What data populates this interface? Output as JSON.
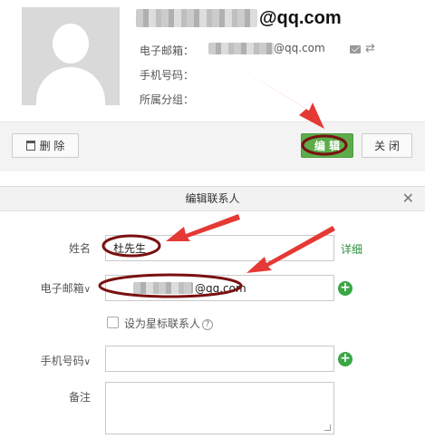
{
  "card": {
    "name_suffix": "@qq.com",
    "labels": {
      "email": "电子邮箱：",
      "phone": "手机号码：",
      "group": "所属分组："
    },
    "email_suffix": "@qq.com",
    "icons": [
      "mail-icon",
      "swap-icon"
    ]
  },
  "toolbar": {
    "delete_label": "删 除",
    "edit_label": "编 辑",
    "close_label": "关 闭"
  },
  "dialog": {
    "title": "编辑联系人",
    "close_glyph": "✕",
    "name_label": "姓名",
    "name_value": "杜先生",
    "detail_link": "详细",
    "email_label": "电子邮箱",
    "email_value_suffix": "@qq.com",
    "star_label": "设为星标联系人",
    "help_glyph": "?",
    "phone_label": "手机号码",
    "phone_value": "",
    "note_label": "备注",
    "note_value": ""
  },
  "colors": {
    "accent_green": "#5cad4a",
    "annotation_red": "#e53935",
    "circle_dark_red": "#7a1010"
  }
}
